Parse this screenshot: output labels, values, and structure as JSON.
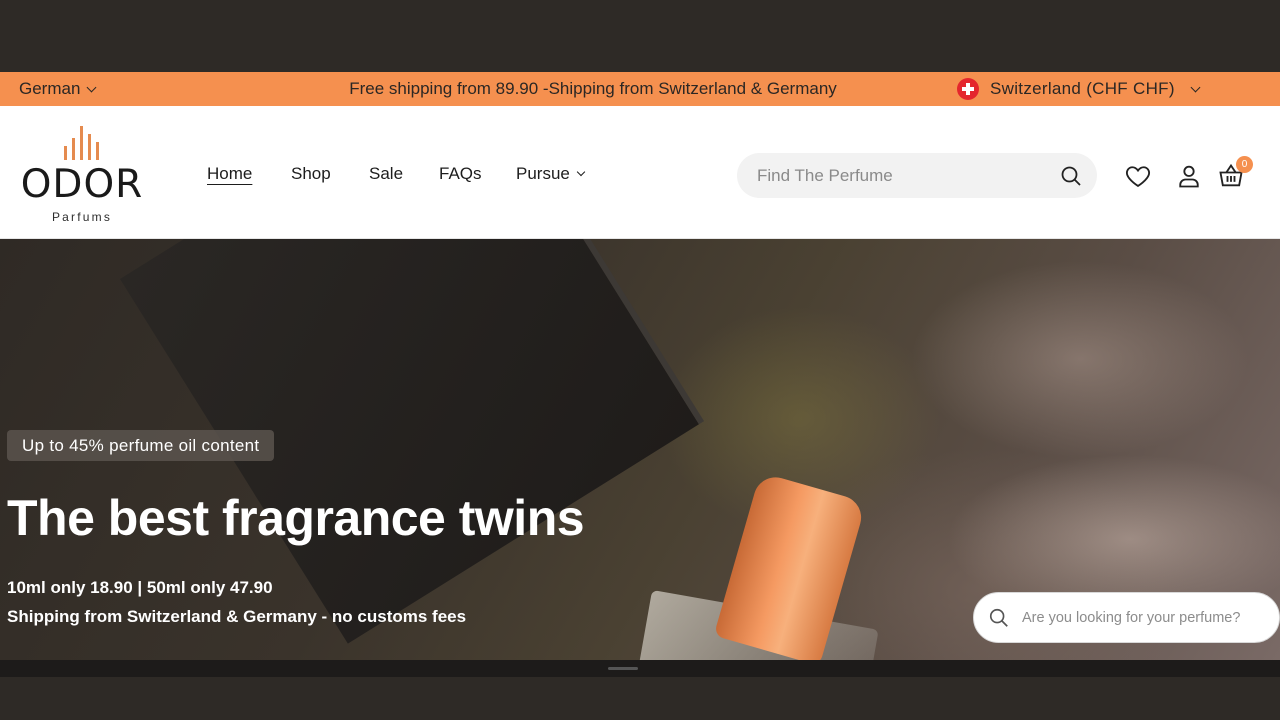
{
  "announcement": {
    "language": "German",
    "text": "Free shipping from 89.90 -Shipping from Switzerland & Germany",
    "country": "Switzerland (CHF CHF)"
  },
  "logo": {
    "word": "ODOR",
    "sub": "Parfums"
  },
  "nav": {
    "items": [
      "Home",
      "Shop",
      "Sale",
      "FAQs",
      "Pursue"
    ]
  },
  "search": {
    "placeholder": "Find The Perfume"
  },
  "cart": {
    "count": "0"
  },
  "hero": {
    "badge": "Up to 45% perfume oil content",
    "title": "The best fragrance twins",
    "line1": "10ml only 18.90 | 50ml only 47.90",
    "line2": "Shipping from Switzerland & Germany - no customs fees"
  },
  "floating_search": {
    "placeholder": "Are you looking for your perfume?"
  },
  "colors": {
    "accent": "#f5904f",
    "dark": "#2e2a26"
  }
}
